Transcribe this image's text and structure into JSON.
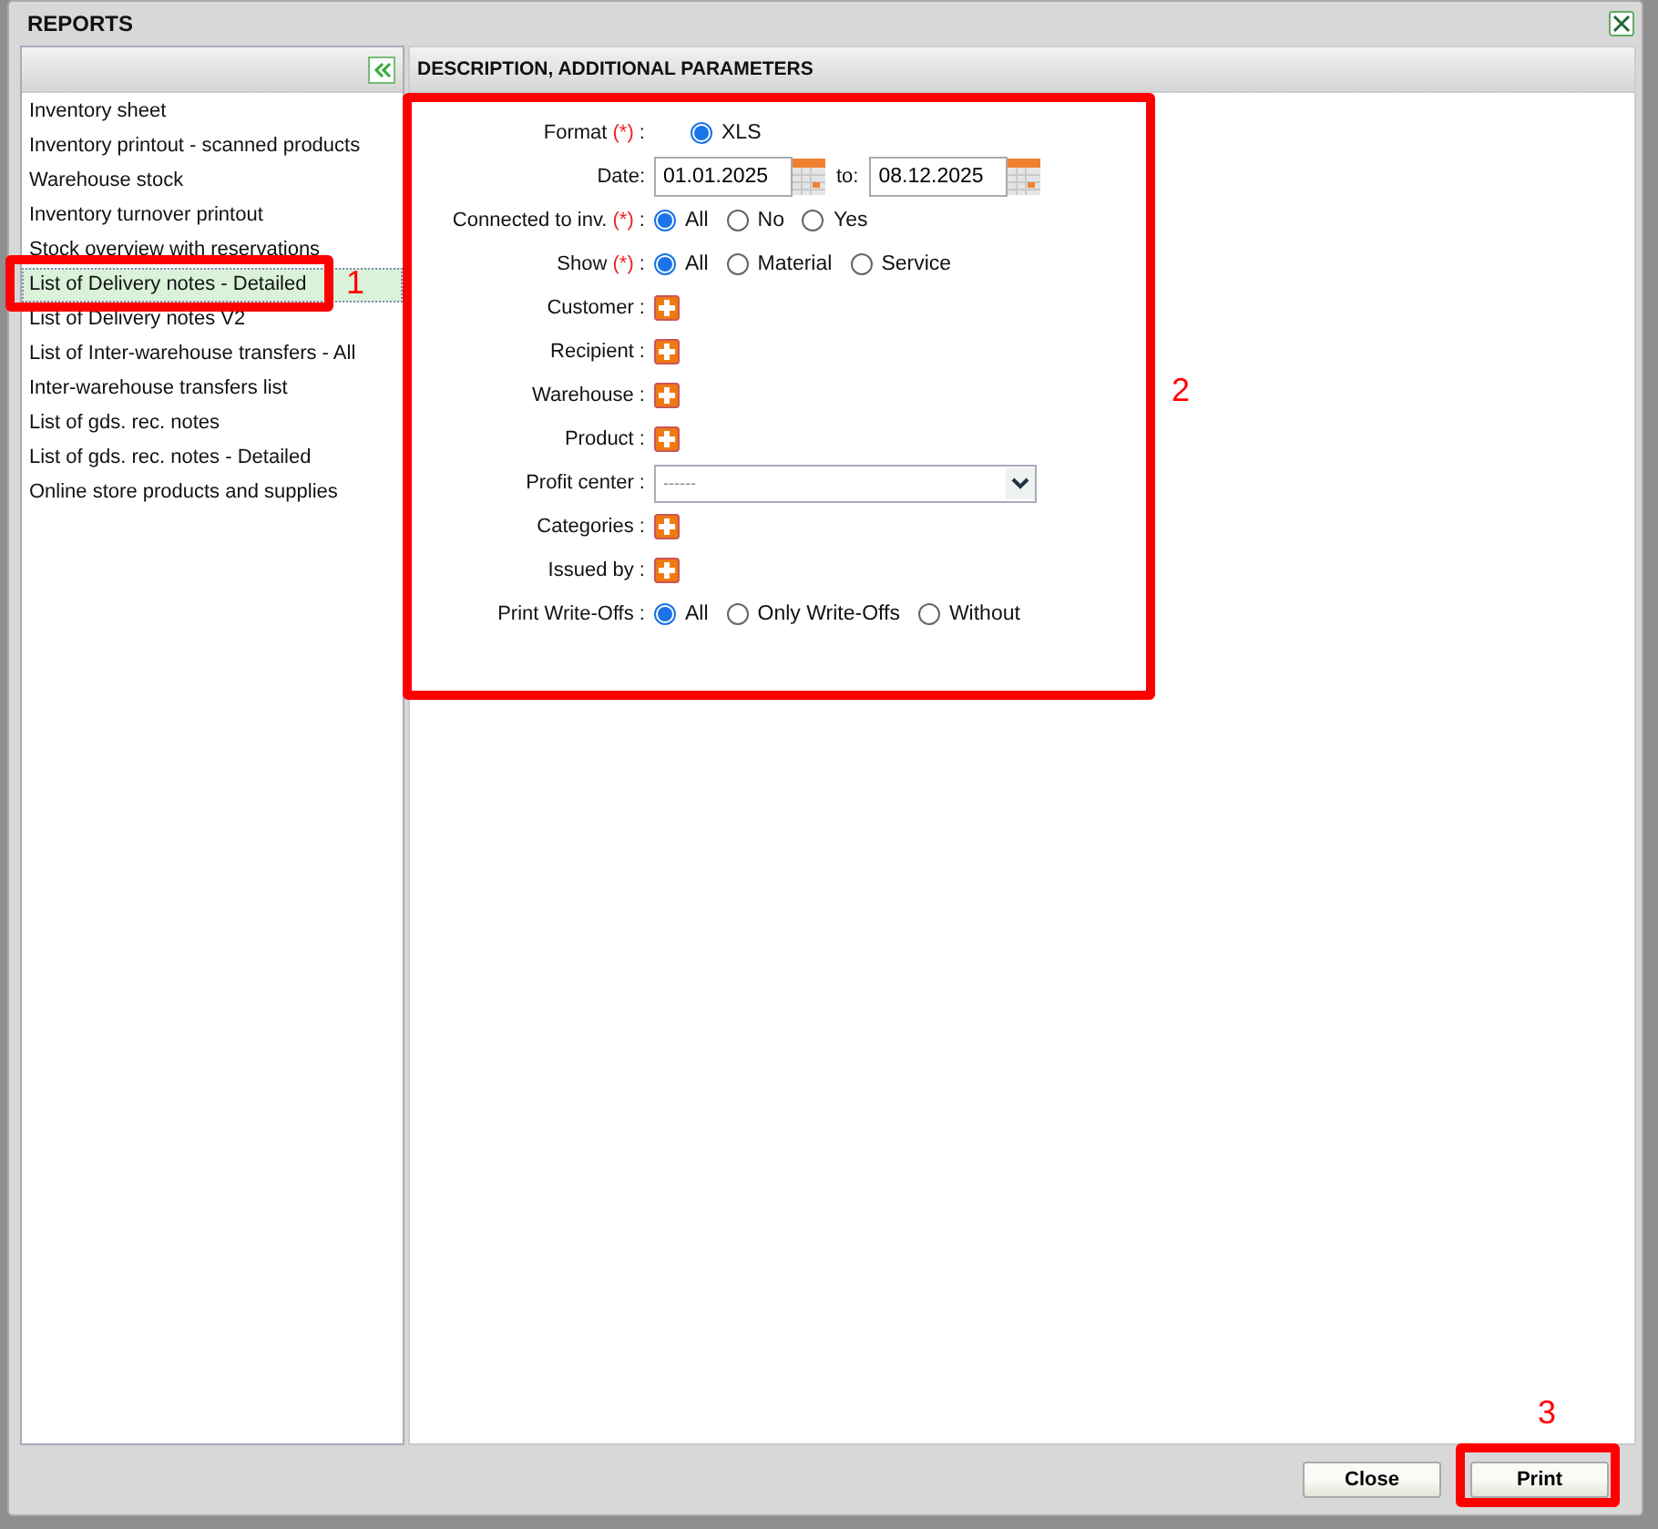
{
  "window": {
    "title": "REPORTS"
  },
  "sidebar": {
    "items": [
      {
        "label": "Inventory sheet",
        "selected": false
      },
      {
        "label": "Inventory printout - scanned products",
        "selected": false
      },
      {
        "label": "Warehouse stock",
        "selected": false
      },
      {
        "label": "Inventory turnover printout",
        "selected": false
      },
      {
        "label": "Stock overview with reservations",
        "selected": false
      },
      {
        "label": "List of Delivery notes - Detailed",
        "selected": true
      },
      {
        "label": "List of Delivery notes V2",
        "selected": false
      },
      {
        "label": "List of Inter-warehouse transfers - All",
        "selected": false
      },
      {
        "label": "Inter-warehouse transfers list",
        "selected": false
      },
      {
        "label": "List of gds. rec. notes",
        "selected": false
      },
      {
        "label": "List of gds. rec. notes - Detailed",
        "selected": false
      },
      {
        "label": "Online store products and supplies",
        "selected": false
      }
    ]
  },
  "panel": {
    "title": "DESCRIPTION, ADDITIONAL PARAMETERS",
    "fields": [
      {
        "kind": "radio",
        "label": "Format",
        "required_mark": "(*)",
        "separator": ":",
        "options": [
          {
            "label": "XLS",
            "selected": true
          }
        ]
      },
      {
        "kind": "daterange",
        "label": "Date:",
        "from": "01.01.2025",
        "to_label": "to:",
        "to": "08.12.2025"
      },
      {
        "kind": "radio",
        "label": "Connected to inv.",
        "required_mark": "(*)",
        "separator": ":",
        "options": [
          {
            "label": "All",
            "selected": true
          },
          {
            "label": "No",
            "selected": false
          },
          {
            "label": "Yes",
            "selected": false
          }
        ]
      },
      {
        "kind": "radio",
        "label": "Show",
        "required_mark": "(*)",
        "separator": ":",
        "options": [
          {
            "label": "All",
            "selected": true
          },
          {
            "label": "Material",
            "selected": false
          },
          {
            "label": "Service",
            "selected": false
          }
        ]
      },
      {
        "kind": "picker",
        "label": "Customer",
        "separator": ":"
      },
      {
        "kind": "picker",
        "label": "Recipient",
        "separator": ":"
      },
      {
        "kind": "picker",
        "label": "Warehouse",
        "separator": ":"
      },
      {
        "kind": "picker",
        "label": "Product",
        "separator": ":"
      },
      {
        "kind": "select",
        "label": "Profit center",
        "separator": ":",
        "value": "------"
      },
      {
        "kind": "picker",
        "label": "Categories",
        "separator": ":"
      },
      {
        "kind": "picker",
        "label": "Issued by",
        "separator": ":"
      },
      {
        "kind": "radio",
        "label": "Print Write-Offs",
        "separator": ":",
        "options": [
          {
            "label": "All",
            "selected": true
          },
          {
            "label": "Only Write-Offs",
            "selected": false
          },
          {
            "label": "Without",
            "selected": false
          }
        ]
      }
    ]
  },
  "buttons": [
    {
      "label": "Close"
    },
    {
      "label": "Print"
    }
  ],
  "annotations": [
    {
      "label": "1"
    },
    {
      "label": "2"
    },
    {
      "label": "3"
    }
  ]
}
